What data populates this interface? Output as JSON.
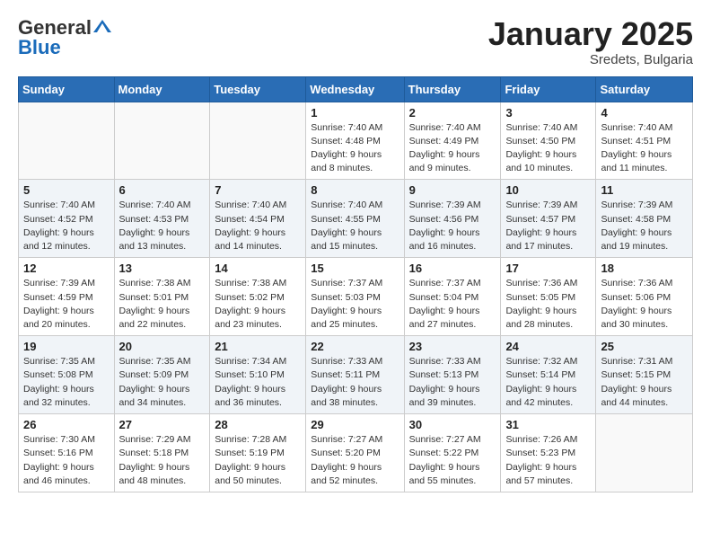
{
  "header": {
    "logo_general": "General",
    "logo_blue": "Blue",
    "month_title": "January 2025",
    "location": "Sredets, Bulgaria"
  },
  "weekdays": [
    "Sunday",
    "Monday",
    "Tuesday",
    "Wednesday",
    "Thursday",
    "Friday",
    "Saturday"
  ],
  "weeks": [
    [
      {
        "day": "",
        "sunrise": "",
        "sunset": "",
        "daylight": ""
      },
      {
        "day": "",
        "sunrise": "",
        "sunset": "",
        "daylight": ""
      },
      {
        "day": "",
        "sunrise": "",
        "sunset": "",
        "daylight": ""
      },
      {
        "day": "1",
        "sunrise": "Sunrise: 7:40 AM",
        "sunset": "Sunset: 4:48 PM",
        "daylight": "Daylight: 9 hours and 8 minutes."
      },
      {
        "day": "2",
        "sunrise": "Sunrise: 7:40 AM",
        "sunset": "Sunset: 4:49 PM",
        "daylight": "Daylight: 9 hours and 9 minutes."
      },
      {
        "day": "3",
        "sunrise": "Sunrise: 7:40 AM",
        "sunset": "Sunset: 4:50 PM",
        "daylight": "Daylight: 9 hours and 10 minutes."
      },
      {
        "day": "4",
        "sunrise": "Sunrise: 7:40 AM",
        "sunset": "Sunset: 4:51 PM",
        "daylight": "Daylight: 9 hours and 11 minutes."
      }
    ],
    [
      {
        "day": "5",
        "sunrise": "Sunrise: 7:40 AM",
        "sunset": "Sunset: 4:52 PM",
        "daylight": "Daylight: 9 hours and 12 minutes."
      },
      {
        "day": "6",
        "sunrise": "Sunrise: 7:40 AM",
        "sunset": "Sunset: 4:53 PM",
        "daylight": "Daylight: 9 hours and 13 minutes."
      },
      {
        "day": "7",
        "sunrise": "Sunrise: 7:40 AM",
        "sunset": "Sunset: 4:54 PM",
        "daylight": "Daylight: 9 hours and 14 minutes."
      },
      {
        "day": "8",
        "sunrise": "Sunrise: 7:40 AM",
        "sunset": "Sunset: 4:55 PM",
        "daylight": "Daylight: 9 hours and 15 minutes."
      },
      {
        "day": "9",
        "sunrise": "Sunrise: 7:39 AM",
        "sunset": "Sunset: 4:56 PM",
        "daylight": "Daylight: 9 hours and 16 minutes."
      },
      {
        "day": "10",
        "sunrise": "Sunrise: 7:39 AM",
        "sunset": "Sunset: 4:57 PM",
        "daylight": "Daylight: 9 hours and 17 minutes."
      },
      {
        "day": "11",
        "sunrise": "Sunrise: 7:39 AM",
        "sunset": "Sunset: 4:58 PM",
        "daylight": "Daylight: 9 hours and 19 minutes."
      }
    ],
    [
      {
        "day": "12",
        "sunrise": "Sunrise: 7:39 AM",
        "sunset": "Sunset: 4:59 PM",
        "daylight": "Daylight: 9 hours and 20 minutes."
      },
      {
        "day": "13",
        "sunrise": "Sunrise: 7:38 AM",
        "sunset": "Sunset: 5:01 PM",
        "daylight": "Daylight: 9 hours and 22 minutes."
      },
      {
        "day": "14",
        "sunrise": "Sunrise: 7:38 AM",
        "sunset": "Sunset: 5:02 PM",
        "daylight": "Daylight: 9 hours and 23 minutes."
      },
      {
        "day": "15",
        "sunrise": "Sunrise: 7:37 AM",
        "sunset": "Sunset: 5:03 PM",
        "daylight": "Daylight: 9 hours and 25 minutes."
      },
      {
        "day": "16",
        "sunrise": "Sunrise: 7:37 AM",
        "sunset": "Sunset: 5:04 PM",
        "daylight": "Daylight: 9 hours and 27 minutes."
      },
      {
        "day": "17",
        "sunrise": "Sunrise: 7:36 AM",
        "sunset": "Sunset: 5:05 PM",
        "daylight": "Daylight: 9 hours and 28 minutes."
      },
      {
        "day": "18",
        "sunrise": "Sunrise: 7:36 AM",
        "sunset": "Sunset: 5:06 PM",
        "daylight": "Daylight: 9 hours and 30 minutes."
      }
    ],
    [
      {
        "day": "19",
        "sunrise": "Sunrise: 7:35 AM",
        "sunset": "Sunset: 5:08 PM",
        "daylight": "Daylight: 9 hours and 32 minutes."
      },
      {
        "day": "20",
        "sunrise": "Sunrise: 7:35 AM",
        "sunset": "Sunset: 5:09 PM",
        "daylight": "Daylight: 9 hours and 34 minutes."
      },
      {
        "day": "21",
        "sunrise": "Sunrise: 7:34 AM",
        "sunset": "Sunset: 5:10 PM",
        "daylight": "Daylight: 9 hours and 36 minutes."
      },
      {
        "day": "22",
        "sunrise": "Sunrise: 7:33 AM",
        "sunset": "Sunset: 5:11 PM",
        "daylight": "Daylight: 9 hours and 38 minutes."
      },
      {
        "day": "23",
        "sunrise": "Sunrise: 7:33 AM",
        "sunset": "Sunset: 5:13 PM",
        "daylight": "Daylight: 9 hours and 39 minutes."
      },
      {
        "day": "24",
        "sunrise": "Sunrise: 7:32 AM",
        "sunset": "Sunset: 5:14 PM",
        "daylight": "Daylight: 9 hours and 42 minutes."
      },
      {
        "day": "25",
        "sunrise": "Sunrise: 7:31 AM",
        "sunset": "Sunset: 5:15 PM",
        "daylight": "Daylight: 9 hours and 44 minutes."
      }
    ],
    [
      {
        "day": "26",
        "sunrise": "Sunrise: 7:30 AM",
        "sunset": "Sunset: 5:16 PM",
        "daylight": "Daylight: 9 hours and 46 minutes."
      },
      {
        "day": "27",
        "sunrise": "Sunrise: 7:29 AM",
        "sunset": "Sunset: 5:18 PM",
        "daylight": "Daylight: 9 hours and 48 minutes."
      },
      {
        "day": "28",
        "sunrise": "Sunrise: 7:28 AM",
        "sunset": "Sunset: 5:19 PM",
        "daylight": "Daylight: 9 hours and 50 minutes."
      },
      {
        "day": "29",
        "sunrise": "Sunrise: 7:27 AM",
        "sunset": "Sunset: 5:20 PM",
        "daylight": "Daylight: 9 hours and 52 minutes."
      },
      {
        "day": "30",
        "sunrise": "Sunrise: 7:27 AM",
        "sunset": "Sunset: 5:22 PM",
        "daylight": "Daylight: 9 hours and 55 minutes."
      },
      {
        "day": "31",
        "sunrise": "Sunrise: 7:26 AM",
        "sunset": "Sunset: 5:23 PM",
        "daylight": "Daylight: 9 hours and 57 minutes."
      },
      {
        "day": "",
        "sunrise": "",
        "sunset": "",
        "daylight": ""
      }
    ]
  ]
}
